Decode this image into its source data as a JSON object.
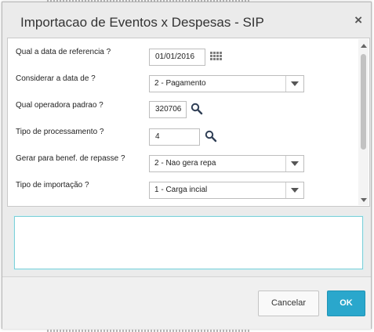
{
  "dialog": {
    "title": "Importacao de Eventos x Despesas - SIP",
    "close_label": "×"
  },
  "form": {
    "fields": [
      {
        "label": "Qual a data de referencia ?",
        "value": "01/01/2016",
        "icon": "calendar-icon"
      },
      {
        "label": "Considerar a data de ?",
        "value": "2 - Pagamento"
      },
      {
        "label": "Qual operadora padrao ?",
        "value": "320706",
        "icon": "search-icon"
      },
      {
        "label": "Tipo de processamento ?",
        "value": "4",
        "icon": "search-icon"
      },
      {
        "label": "Gerar para benef. de repasse ?",
        "value": "2 - Nao gera repa"
      },
      {
        "label": "Tipo de importação ?",
        "value": "1 - Carga incial"
      }
    ]
  },
  "footer": {
    "cancel_label": "Cancelar",
    "ok_label": "OK"
  },
  "colors": {
    "accent": "#2aa7cc",
    "focus_border": "#7ecfd8"
  }
}
